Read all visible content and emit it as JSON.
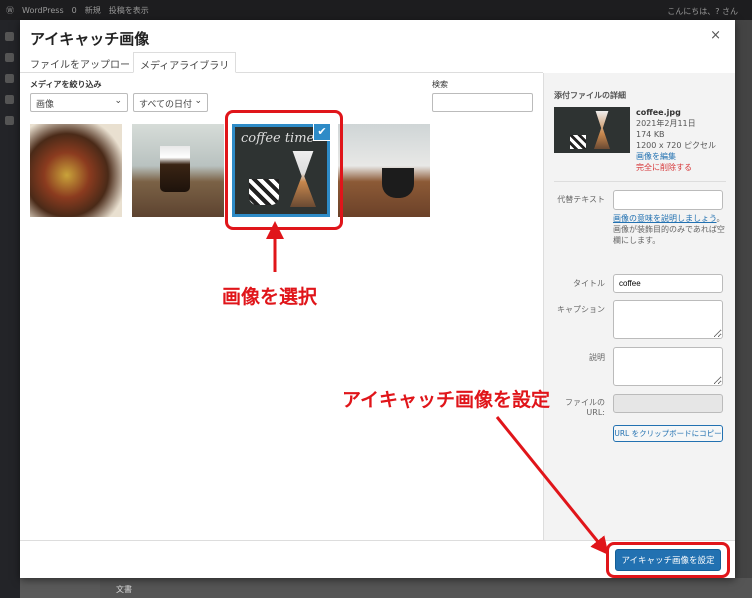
{
  "admin_bar": {
    "site": "WordPress",
    "comments": "0",
    "new": "新規",
    "view_post": "投稿を表示",
    "greeting": "こんにちは、? さん"
  },
  "below": {
    "text": "文書"
  },
  "modal": {
    "title": "アイキャッチ画像",
    "close": "×",
    "tabs": [
      {
        "label": "ファイルをアップロード"
      },
      {
        "label": "メディアライブラリ"
      }
    ],
    "filter_label": "メディアを絞り込み",
    "filter_type": "画像",
    "filter_date": "すべての日付",
    "search_label": "検索",
    "search_value": "",
    "thumbnails": [
      {
        "alt": "sandwich"
      },
      {
        "alt": "glass coffee"
      },
      {
        "alt": "coffee",
        "text": "coffee time",
        "selected": true
      },
      {
        "alt": "plant"
      }
    ],
    "check": "✔"
  },
  "annotations": {
    "select": "画像を選択",
    "set": "アイキャッチ画像を設定",
    "color": "#e0151a"
  },
  "details": {
    "heading": "添付ファイルの詳細",
    "filename": "coffee.jpg",
    "date": "2021年2月11日",
    "size": "174 KB",
    "dimensions": "1200 x 720 ピクセル",
    "edit": "画像を編集",
    "delete": "完全に削除する",
    "alt_label": "代替テキスト",
    "alt_value": "",
    "alt_help_link": "画像の意味を説明しましょう",
    "alt_help_text": "。画像が装飾目的のみであれば空欄にします。",
    "title_label": "タイトル",
    "title_value": "coffee",
    "caption_label": "キャプション",
    "caption_value": "",
    "desc_label": "説明",
    "desc_value": "",
    "url_label": "ファイルの URL:",
    "copy_button": "URL をクリップボードにコピー"
  },
  "footer": {
    "primary_button": "アイキャッチ画像を設定",
    "accent": "#2271b1"
  }
}
